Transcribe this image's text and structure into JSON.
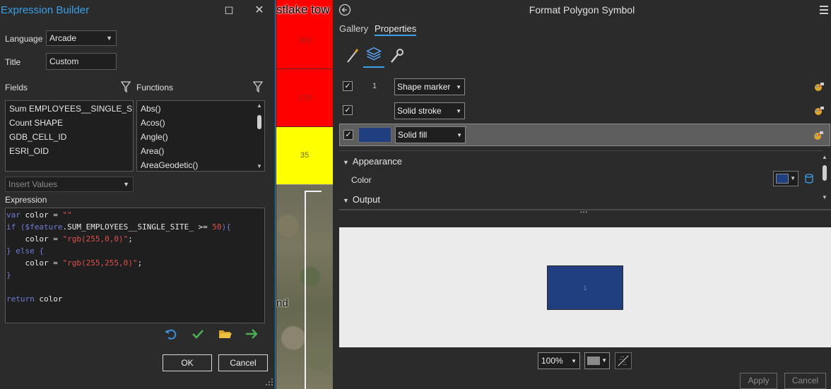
{
  "expression_builder": {
    "title": "Expression Builder",
    "language_label": "Language",
    "language_value": "Arcade",
    "title_label": "Title",
    "title_value": "Custom",
    "fields_label": "Fields",
    "functions_label": "Functions",
    "fields": [
      "Sum EMPLOYEES__SINGLE_SITE_",
      "Count SHAPE",
      "GDB_CELL_ID",
      "ESRI_OID"
    ],
    "functions": [
      "Abs()",
      "Acos()",
      "Angle()",
      "Area()",
      "AreaGeodetic()"
    ],
    "insert_values_placeholder": "Insert Values",
    "expression_label": "Expression",
    "code": {
      "l1_kw": "var",
      "l1_rest": " color = ",
      "l1_str": "\"\"",
      "l2_kw": "if (",
      "l2_var": "$feature",
      "l2_field": ".SUM_EMPLOYEES__SINGLE_SITE_",
      "l2_op": " >= ",
      "l2_num": "50",
      "l2_end": "){",
      "l3_plain": "    color = ",
      "l3_str": "\"rgb(255,0,0)\"",
      "l3_end": ";",
      "l4_kw": "} else {",
      "l5_plain": "    color = ",
      "l5_str": "\"rgb(255,255,0)\"",
      "l5_end": ";",
      "l6_kw": "}",
      "l8_kw": "return",
      "l8_plain": " color"
    },
    "ok_label": "OK",
    "cancel_label": "Cancel"
  },
  "map": {
    "header_text": "stlake tow",
    "cells": [
      "393",
      "170",
      "35"
    ],
    "colors": {
      "red": "#ff0000",
      "yellow": "#ffff00"
    },
    "label_fragment": "nd"
  },
  "format_polygon_symbol": {
    "title": "Format Polygon Symbol",
    "tabs": [
      "Gallery",
      "Properties"
    ],
    "active_tab": "Properties",
    "subtabs": [
      "brush-icon",
      "layers-icon",
      "wrench-icon"
    ],
    "layers": [
      {
        "number": "1",
        "type": "Shape marker",
        "checked": true
      },
      {
        "number": "",
        "type": "Solid stroke",
        "checked": true
      },
      {
        "number": "",
        "type": "Solid fill",
        "checked": true,
        "selected": true
      }
    ],
    "appearance_label": "Appearance",
    "color_label": "Color",
    "fill_color": "#1f3f80",
    "output_label": "Output",
    "preview_label": "1",
    "zoom_value": "100%",
    "apply_label": "Apply",
    "cancel_label": "Cancel"
  }
}
